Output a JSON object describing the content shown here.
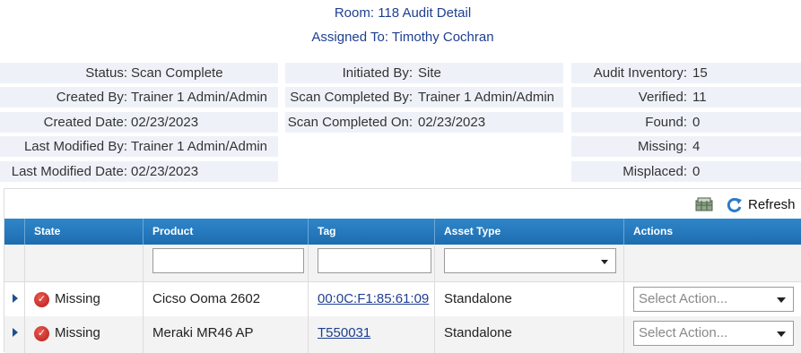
{
  "header": {
    "title": "Room: 118 Audit Detail",
    "assigned": "Assigned To: Timothy Cochran"
  },
  "details": {
    "col1": [
      {
        "label": "Status:",
        "value": "Scan Complete"
      },
      {
        "label": "Created By:",
        "value": "Trainer 1 Admin/Admin"
      },
      {
        "label": "Created Date:",
        "value": "02/23/2023"
      },
      {
        "label": "Last Modified By:",
        "value": "Trainer 1 Admin/Admin"
      },
      {
        "label": "Last Modified Date:",
        "value": "02/23/2023"
      }
    ],
    "col2": [
      {
        "label": "Initiated By:",
        "value": "Site"
      },
      {
        "label": "Scan Completed By:",
        "value": "Trainer 1 Admin/Admin"
      },
      {
        "label": "Scan Completed On:",
        "value": "02/23/2023"
      }
    ],
    "col3": [
      {
        "label": "Audit Inventory:",
        "value": "15"
      },
      {
        "label": "Verified:",
        "value": "11"
      },
      {
        "label": "Found:",
        "value": "0"
      },
      {
        "label": "Missing:",
        "value": "4"
      },
      {
        "label": "Misplaced:",
        "value": "0"
      }
    ]
  },
  "toolbar": {
    "export_icon": "spreadsheet-export-icon",
    "refresh_icon": "refresh-icon",
    "refresh_label": "Refresh"
  },
  "grid": {
    "columns": [
      "State",
      "Product",
      "Tag",
      "Asset Type",
      "Actions"
    ],
    "rows": [
      {
        "state": "Missing",
        "product": "Cicso Ooma 2602",
        "tag": "00:0C:F1:85:61:09",
        "asset_type": "Standalone",
        "action_placeholder": "Select Action..."
      },
      {
        "state": "Missing",
        "product": "Meraki MR46 AP",
        "tag": "T550031",
        "asset_type": "Standalone",
        "action_placeholder": "Select Action..."
      }
    ]
  },
  "colors": {
    "accent": "#1f3f8f",
    "header_bg": "#2478bd",
    "missing": "#c62828"
  }
}
